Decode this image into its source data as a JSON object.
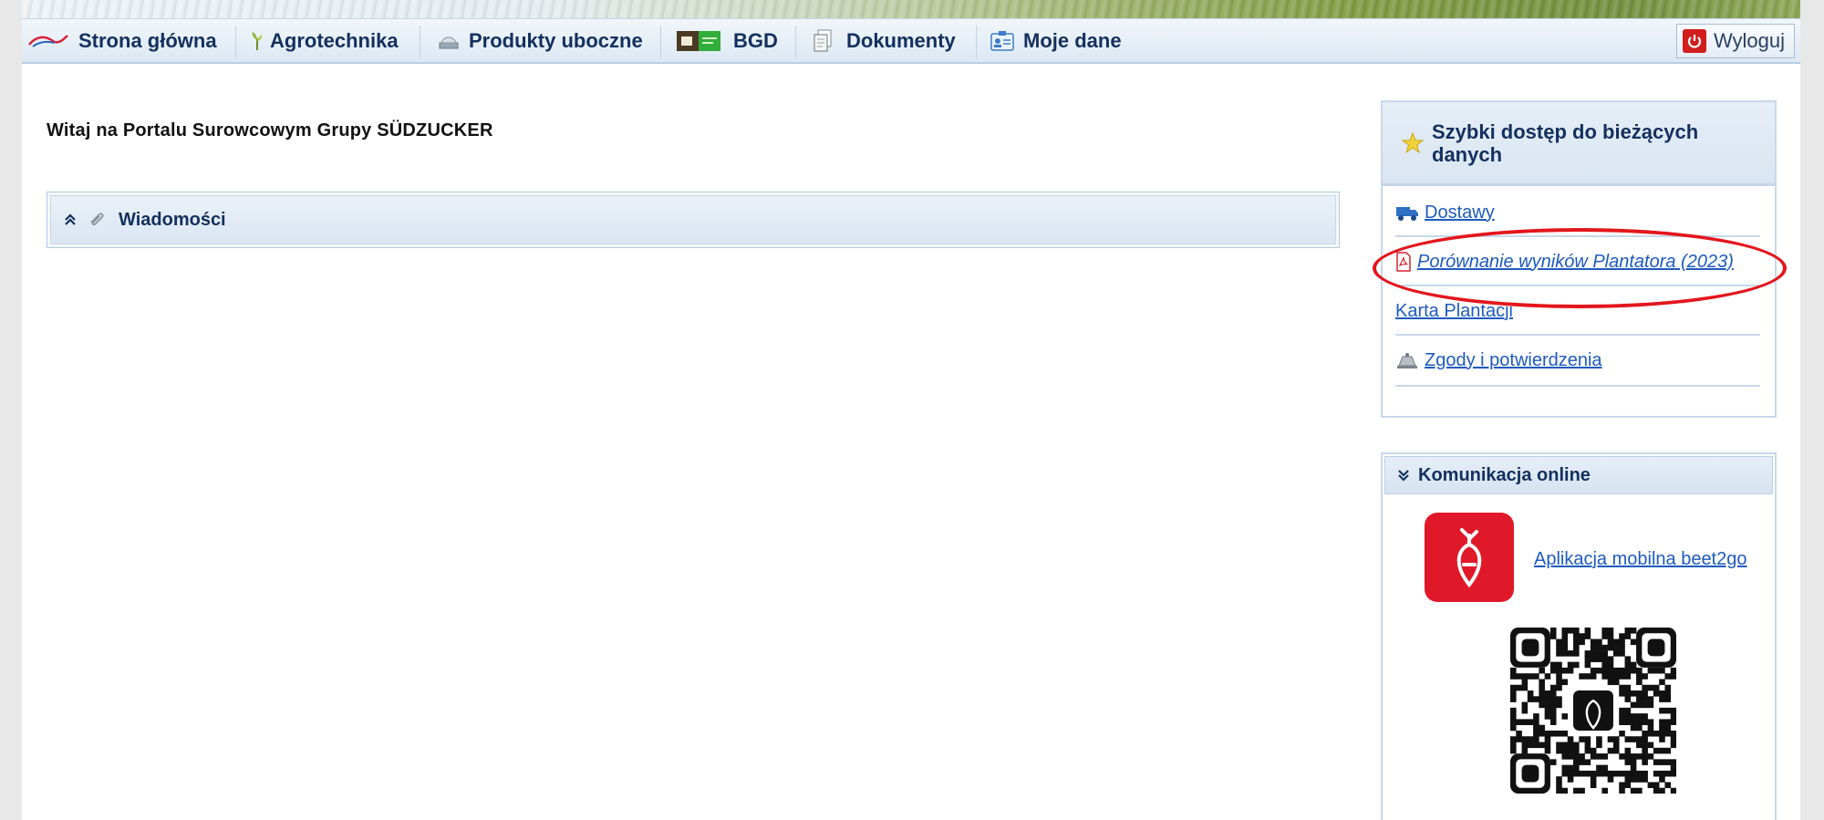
{
  "nav": {
    "items": [
      {
        "label": "Strona główna"
      },
      {
        "label": "Agrotechnika"
      },
      {
        "label": "Produkty uboczne"
      },
      {
        "label": "BGD"
      },
      {
        "label": "Dokumenty"
      },
      {
        "label": "Moje dane"
      }
    ],
    "logout_label": "Wyloguj"
  },
  "main": {
    "welcome": "Witaj na Portalu Surowcowym Grupy SÜDZUCKER",
    "messages_panel_title": "Wiadomości"
  },
  "quick_access": {
    "title": "Szybki dostęp do bieżących danych",
    "links": [
      {
        "label": "Dostawy"
      },
      {
        "label": "Porównanie wyników Plantatora (2023)"
      },
      {
        "label": "Karta Plantacji"
      },
      {
        "label": "Zgody i potwierdzenia"
      }
    ]
  },
  "communication": {
    "title": "Komunikacja online",
    "app_link": "Aplikacja mobilna beet2go"
  },
  "colors": {
    "nav_text": "#14305e",
    "link": "#1d5bbd",
    "highlight_ellipse": "#e3161c",
    "app_icon_bg": "#e0192a"
  }
}
